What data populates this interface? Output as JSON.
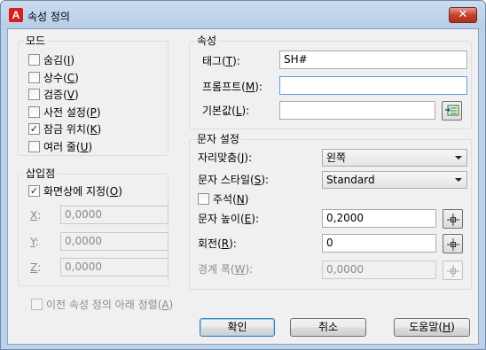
{
  "window": {
    "title": "속성 정의",
    "close_label": "✕"
  },
  "mode": {
    "title": "모드",
    "items": [
      {
        "text": "숨김(",
        "key": "I",
        "end": ")",
        "checked": false
      },
      {
        "text": "상수(",
        "key": "C",
        "end": ")",
        "checked": false
      },
      {
        "text": "검증(",
        "key": "V",
        "end": ")",
        "checked": false
      },
      {
        "text": "사전 설정(",
        "key": "P",
        "end": ")",
        "checked": false
      },
      {
        "text": "잠금 위치(",
        "key": "K",
        "end": ")",
        "checked": true
      },
      {
        "text": "여러 줄(",
        "key": "U",
        "end": ")",
        "checked": false
      }
    ]
  },
  "insertion": {
    "title": "삽입점",
    "specify": {
      "text": "화면상에 지정(",
      "key": "O",
      "end": ")",
      "checked": true
    },
    "x": {
      "key": "X",
      "end": ":",
      "value": "0,0000"
    },
    "y": {
      "key": "Y",
      "end": ":",
      "value": "0,0000"
    },
    "z": {
      "key": "Z",
      "end": ":",
      "value": "0,0000"
    }
  },
  "attribute": {
    "title": "속성",
    "tag": {
      "text": "태그(",
      "key": "T",
      "end": "):",
      "value": "SH#"
    },
    "prompt": {
      "text": "프롬프트(",
      "key": "M",
      "end": "):",
      "value": ""
    },
    "default": {
      "text": "기본값(",
      "key": "L",
      "end": "):",
      "value": ""
    }
  },
  "text_settings": {
    "title": "문자 설정",
    "justify": {
      "text": "자리맞춤(",
      "key": "J",
      "end": "):",
      "value": "왼쪽"
    },
    "style": {
      "text": "문자 스타일(",
      "key": "S",
      "end": "):",
      "value": "Standard"
    },
    "annotative": {
      "text": "주석(",
      "key": "N",
      "end": ")",
      "checked": false
    },
    "height": {
      "text": "문자 높이(",
      "key": "E",
      "end": "):",
      "value": "0,2000"
    },
    "rotation": {
      "text": "회전(",
      "key": "R",
      "end": "):",
      "value": "0"
    },
    "boundary": {
      "text": "경계 폭(",
      "key": "W",
      "end": "):",
      "value": "0,0000"
    }
  },
  "align_below": {
    "text": "이전 속성 정의 아래 정렬(",
    "key": "A",
    "end": ")",
    "checked": false
  },
  "buttons": {
    "ok": "확인",
    "cancel": "취소",
    "help": {
      "text": "도움말(",
      "key": "H",
      "end": ")"
    }
  },
  "colors": {
    "titlebar": "#bcd2ea",
    "close": "#c4412b",
    "dialog_bg": "#f0f0f0",
    "focus_border": "#569de5"
  }
}
